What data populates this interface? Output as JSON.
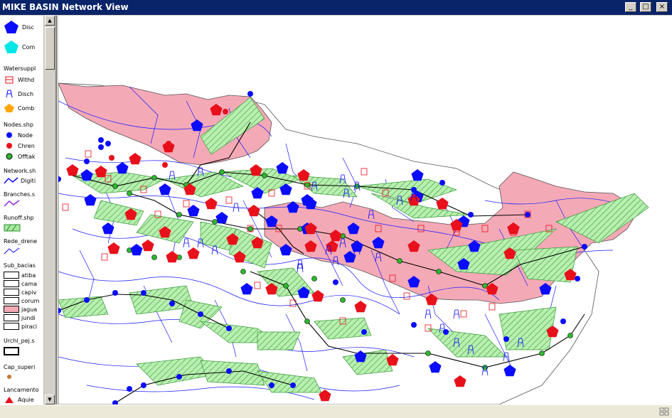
{
  "window": {
    "title": "MIKE BASIN Network View",
    "minimize_glyph": "_",
    "maximize_glyph": "□",
    "close_glyph": "×"
  },
  "legend": {
    "disc_label": "Disc",
    "com_label": "Com",
    "watersupply_title": "Watersuppl",
    "withd_label": "Withd",
    "disch_label": "Disch",
    "comb_label": "Comb",
    "nodes_title": "Nodes.shp",
    "node_label": "Node",
    "chren_label": "Chren",
    "offtak_label": "Offtak",
    "network_title": "Network.sh",
    "digiti_label": "Digiti",
    "branches_title": "Branches.s",
    "runoff_title": "Runoff.shp",
    "rede_title": "Rede_drene",
    "subbacias_title": "Sub_bacias",
    "subbacias": [
      "atiba",
      "cama",
      "capiv",
      "corum",
      "jagua",
      "jundi",
      "piraci"
    ],
    "urchi_title": "Urchi_pej.s",
    "cap_title": "Cap_superi",
    "lancamentos_title": "Lancamento",
    "aquie_label": "Aquie"
  },
  "colors": {
    "basin_pink": "#f4a9b6",
    "river_blue": "#1a1aff",
    "node_blue": "#0b0bff",
    "node_red": "#e8101a",
    "offtake_green": "#2db82d",
    "runoff_green": "#a8e8a0",
    "titlebar": "#0a246a"
  }
}
